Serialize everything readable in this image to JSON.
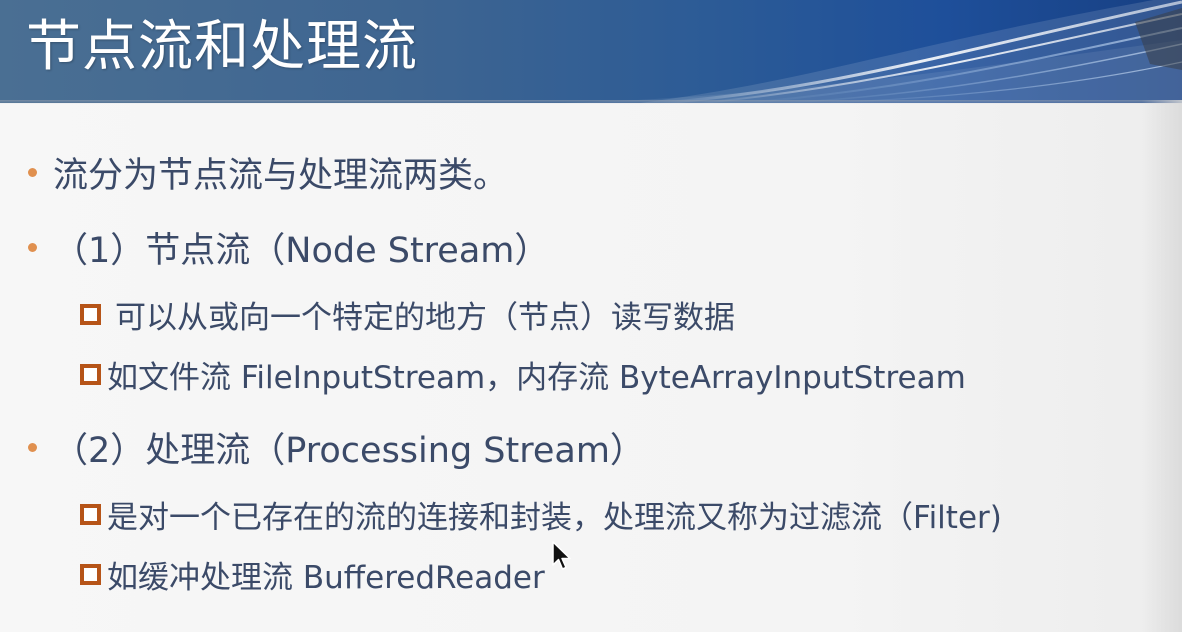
{
  "slide": {
    "title": "节点流和处理流",
    "bullets": [
      {
        "text": "流分为节点流与处理流两类。",
        "subitems": []
      },
      {
        "text": "（1）节点流（Node Stream）",
        "subitems": [
          "可以从或向一个特定的地方（节点）读写数据",
          "如文件流 FileInputStream，内存流 ByteArrayInputStream"
        ]
      },
      {
        "text": "（2）处理流（Processing Stream）",
        "subitems": [
          "是对一个已存在的流的连接和封装，处理流又称为过滤流（Filter)",
          "如缓冲处理流 BufferedReader"
        ]
      }
    ]
  },
  "colors": {
    "header_blue": "#1e4f9a",
    "text": "#3b4a68",
    "bullet_dot": "#e0904f",
    "square_bullet": "#b65418"
  },
  "icons": {
    "bullet_level1": "dot-bullet-icon",
    "bullet_level2": "square-bullet-icon",
    "pointer": "mouse-cursor-icon"
  }
}
